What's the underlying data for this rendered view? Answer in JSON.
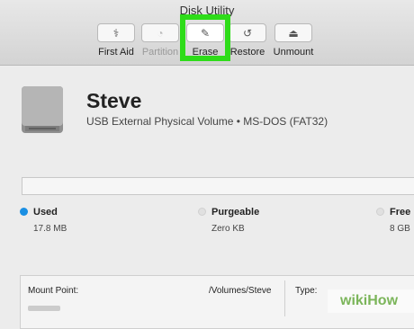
{
  "window": {
    "title": "Disk Utility"
  },
  "toolbar": {
    "buttons": [
      {
        "label": "First Aid",
        "icon": "stethoscope-icon",
        "glyph": "⚕"
      },
      {
        "label": "Partition",
        "icon": "partition-icon",
        "glyph": "◔"
      },
      {
        "label": "Erase",
        "icon": "erase-icon",
        "glyph": "✎"
      },
      {
        "label": "Restore",
        "icon": "restore-icon",
        "glyph": "↺"
      },
      {
        "label": "Unmount",
        "icon": "eject-icon",
        "glyph": "⏏"
      }
    ],
    "highlight_color": "#2edc19"
  },
  "volume": {
    "name": "Steve",
    "subtitle": "USB External Physical Volume • MS-DOS (FAT32)"
  },
  "usage": {
    "used": {
      "label": "Used",
      "value": "17.8 MB",
      "color": "#1a8fe3"
    },
    "purgeable": {
      "label": "Purgeable",
      "value": "Zero KB",
      "color": "#e0e0e0"
    },
    "free": {
      "label": "Free",
      "value": "8 GB",
      "color": "#e0e0e0"
    }
  },
  "info": {
    "mount_point_label": "Mount Point:",
    "mount_point_value": "/Volumes/Steve",
    "type_label": "Type:"
  },
  "watermark": "wikiHow"
}
